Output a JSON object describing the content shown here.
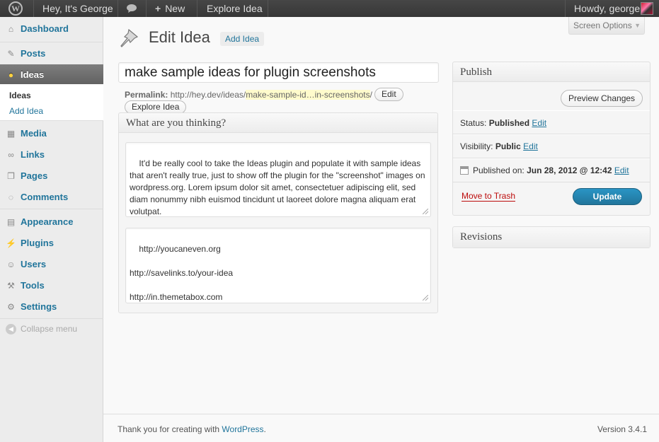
{
  "adminbar": {
    "site_name": "Hey, It's George",
    "new_label": "New",
    "explore_label": "Explore Idea",
    "howdy": "Howdy, george"
  },
  "sidebar": {
    "items": [
      {
        "label": "Dashboard",
        "icon": "dashboard-icon"
      },
      {
        "label": "Posts",
        "icon": "pin-icon"
      },
      {
        "label": "Ideas",
        "icon": "lightbulb-icon"
      },
      {
        "label": "Media",
        "icon": "media-icon"
      },
      {
        "label": "Links",
        "icon": "link-icon"
      },
      {
        "label": "Pages",
        "icon": "pages-icon"
      },
      {
        "label": "Comments",
        "icon": "comment-icon"
      },
      {
        "label": "Appearance",
        "icon": "appearance-icon"
      },
      {
        "label": "Plugins",
        "icon": "plugin-icon"
      },
      {
        "label": "Users",
        "icon": "users-icon"
      },
      {
        "label": "Tools",
        "icon": "tools-icon"
      },
      {
        "label": "Settings",
        "icon": "settings-icon"
      }
    ],
    "submenu": [
      "Ideas",
      "Add Idea"
    ],
    "collapse": "Collapse menu"
  },
  "screen_options": "Screen Options",
  "header": {
    "title": "Edit Idea",
    "add_new": "Add Idea"
  },
  "editor": {
    "title_value": "make sample ideas for plugin screenshots",
    "permalink_label": "Permalink:",
    "permalink_base": "http://hey.dev/ideas/",
    "permalink_slug": "make-sample-id…in-screenshots",
    "permalink_end": "/",
    "edit_button": "Edit",
    "explore_button": "Explore Idea"
  },
  "thinking_box": {
    "title": "What are you thinking?",
    "description": "It'd be really cool to take the Ideas plugin and populate it with sample ideas that aren't really true, just to show off the plugin for the \"screenshot\" images on wordpress.org. Lorem ipsum dolor sit amet, consectetuer adipiscing elit, sed diam nonummy nibh euismod tincidunt ut laoreet dolore magna aliquam erat volutpat.",
    "links": "http://youcaneven.org\n\nhttp://savelinks.to/your-idea\n\nhttp://in.themetabox.com"
  },
  "publish": {
    "title": "Publish",
    "preview": "Preview Changes",
    "status_label": "Status:",
    "status_value": "Published",
    "visibility_label": "Visibility:",
    "visibility_value": "Public",
    "published_label": "Published on:",
    "published_value": "Jun 28, 2012 @ 12:42",
    "edit_link": "Edit",
    "trash": "Move to Trash",
    "update": "Update"
  },
  "revisions": {
    "title": "Revisions"
  },
  "footer": {
    "thanks": "Thank you for creating with ",
    "wp_link": "WordPress",
    "period": ".",
    "version": "Version 3.4.1"
  },
  "colors": {
    "link": "#21759b",
    "update_button": "#21759b",
    "trash": "#bc0b0b",
    "current_menu": "#6d6d6d",
    "adminbar": "#464646"
  }
}
